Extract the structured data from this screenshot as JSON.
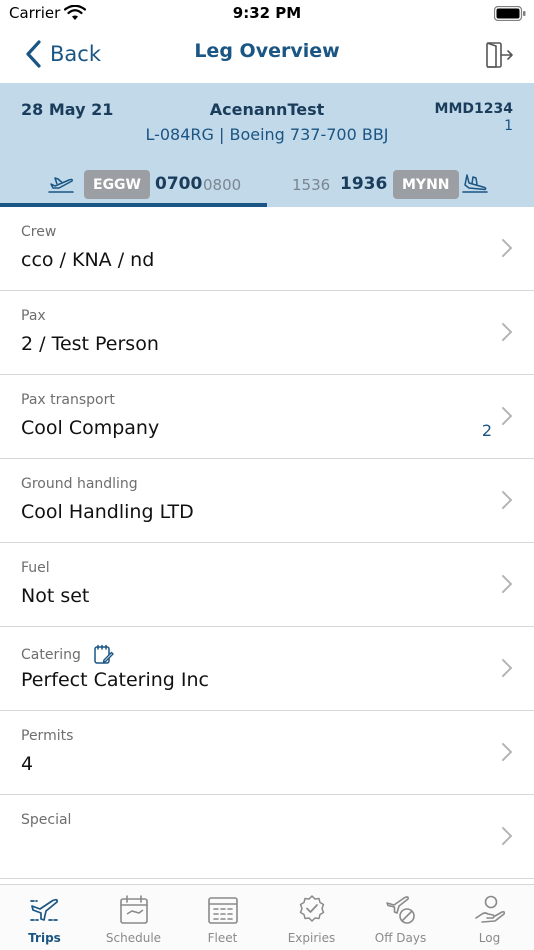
{
  "status_bar": {
    "carrier": "Carrier",
    "time": "9:32 PM"
  },
  "nav": {
    "back_label": "Back",
    "title": "Leg Overview",
    "exit_icon": "door-exit-icon"
  },
  "leg": {
    "date": "28 May 21",
    "customer": "AcenannTest",
    "aircraft": "L-084RG | Boeing 737-700 BBJ",
    "trip_code": "MMD1234",
    "trip_number": "1",
    "departure": {
      "airport": "EGGW",
      "time_actual": "0700",
      "time_scheduled": "0800"
    },
    "arrival": {
      "airport": "MYNN",
      "time_scheduled": "1536",
      "time_actual": "1936"
    },
    "progress": 0.5
  },
  "items": [
    {
      "title": "Crew",
      "value": "cco / KNA / nd",
      "badge": ""
    },
    {
      "title": "Pax",
      "value": "2 / Test Person",
      "badge": ""
    },
    {
      "title": "Pax transport",
      "value": "Cool Company",
      "badge": "2"
    },
    {
      "title": "Ground handling",
      "value": "Cool Handling LTD",
      "badge": ""
    },
    {
      "title": "Fuel",
      "value": "Not set",
      "badge": ""
    },
    {
      "title": "Catering",
      "value": "Perfect Catering Inc",
      "badge": ""
    },
    {
      "title": "Permits",
      "value": "4",
      "badge": ""
    },
    {
      "title": "Special",
      "value": "",
      "badge": ""
    }
  ],
  "tabs": [
    {
      "label": "Trips",
      "icon": "plane-route-icon",
      "active": true
    },
    {
      "label": "Schedule",
      "icon": "calendar-icon",
      "active": false
    },
    {
      "label": "Fleet",
      "icon": "fleet-board-icon",
      "active": false
    },
    {
      "label": "Expiries",
      "icon": "badge-check-icon",
      "active": false
    },
    {
      "label": "Off Days",
      "icon": "plane-off-icon",
      "active": false
    },
    {
      "label": "Log",
      "icon": "person-hand-icon",
      "active": false
    }
  ],
  "colors": {
    "accent": "#1a5583",
    "header_bg": "#c2d9ea",
    "badge_bg": "#9b9fa3"
  }
}
